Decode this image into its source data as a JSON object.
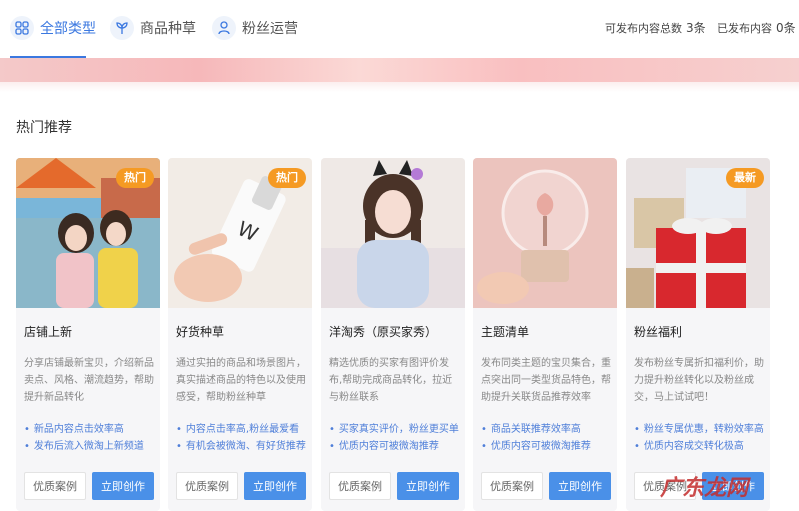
{
  "tabs": [
    {
      "label": "全部类型",
      "icon": "grid-icon"
    },
    {
      "label": "商品种草",
      "icon": "sprout-icon"
    },
    {
      "label": "粉丝运营",
      "icon": "fans-icon"
    }
  ],
  "stats": {
    "publishable_label": "可发布内容总数",
    "publishable_value": "3条",
    "published_label": "已发布内容",
    "published_value": "0条"
  },
  "section_title": "热门推荐",
  "cards": [
    {
      "badge": "热门",
      "title": "店铺上新",
      "desc": "分享店铺最新宝贝，介绍新品卖点、风格、潮流趋势，帮助提升新品转化",
      "bullets": [
        "新品内容点击效率高",
        "发布后流入微淘上新频道"
      ],
      "btn_example": "优质案例",
      "btn_create": "立即创作"
    },
    {
      "badge": "热门",
      "title": "好货种草",
      "desc": "通过实拍的商品和场景图片，真实描述商品的特色以及使用感受，帮助粉丝种草",
      "bullets": [
        "内容点击率高,粉丝最爱看",
        "有机会被微淘、有好货推荐"
      ],
      "btn_example": "优质案例",
      "btn_create": "立即创作"
    },
    {
      "badge": "",
      "title": "洋淘秀（原买家秀）",
      "desc": "精选优质的买家有图评价发布,帮助完成商品转化，拉近与粉丝联系",
      "bullets": [
        "买家真实评价，粉丝更买单",
        "优质内容可被微淘推荐"
      ],
      "btn_example": "优质案例",
      "btn_create": "立即创作"
    },
    {
      "badge": "",
      "title": "主题清单",
      "desc": "发布同类主题的宝贝集合，重点突出同一类型货品特色，帮助提升关联货品推荐效率",
      "bullets": [
        "商品关联推荐效率高",
        "优质内容可被微淘推荐"
      ],
      "btn_example": "优质案例",
      "btn_create": "立即创作"
    },
    {
      "badge": "最新",
      "title": "粉丝福利",
      "desc": "发布粉丝专属折扣福利价，助力提升粉丝转化以及粉丝成交，马上试试吧！",
      "bullets": [
        "粉丝专属优惠，转粉效率高",
        "优质内容成交转化极高"
      ],
      "btn_example": "优质案例",
      "btn_create": "立即创作"
    }
  ],
  "watermark": "广东龙网",
  "colors": {
    "accent": "#3b78e0",
    "badge": "#f59a23",
    "primary_button": "#4a90e8"
  }
}
